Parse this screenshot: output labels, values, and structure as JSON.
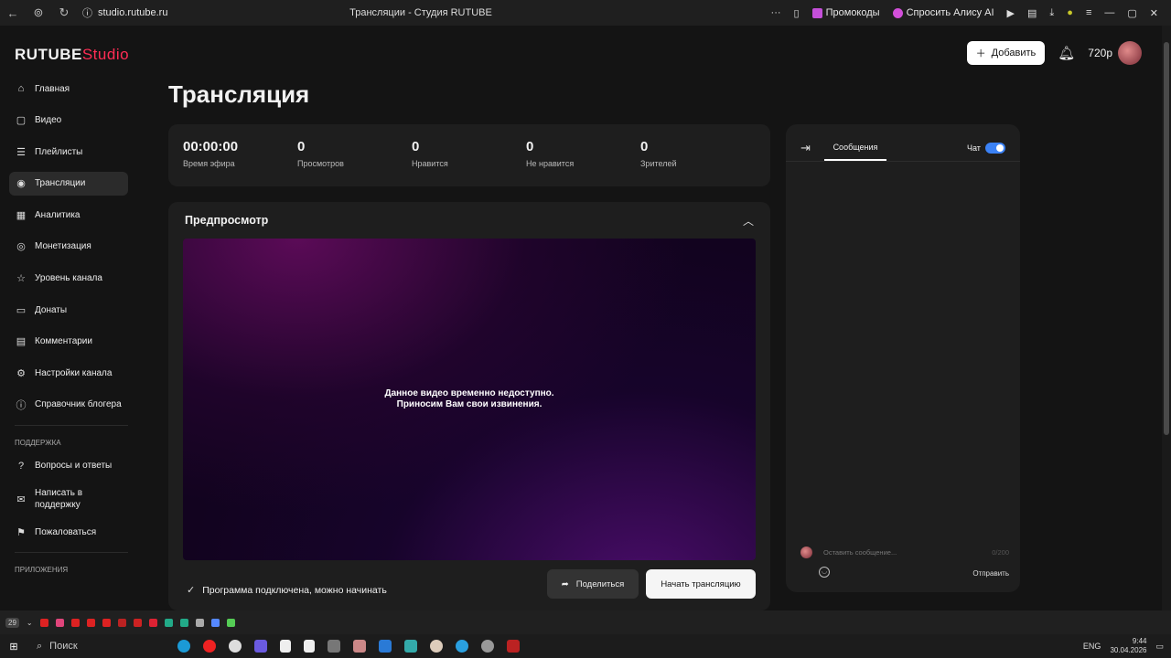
{
  "browser": {
    "url": "studio.rutube.ru",
    "tab_title": "Трансляции - Студия RUTUBE",
    "promo_label": "Промокоды",
    "alice_label": "Спросить Алису AI"
  },
  "header": {
    "logo_main": "RUTUBE",
    "logo_studio": "Studio",
    "add_button": "Добавить",
    "balance": "720р"
  },
  "sidebar": {
    "items": [
      {
        "label": "Главная",
        "icon": "home-icon"
      },
      {
        "label": "Видео",
        "icon": "video-icon"
      },
      {
        "label": "Плейлисты",
        "icon": "playlist-icon"
      },
      {
        "label": "Трансляции",
        "icon": "broadcast-icon",
        "active": true
      },
      {
        "label": "Аналитика",
        "icon": "analytics-icon"
      },
      {
        "label": "Монетизация",
        "icon": "money-icon"
      },
      {
        "label": "Уровень канала",
        "icon": "star-icon"
      },
      {
        "label": "Донаты",
        "icon": "donate-icon"
      },
      {
        "label": "Комментарии",
        "icon": "comments-icon"
      },
      {
        "label": "Настройки канала",
        "icon": "gear-icon"
      },
      {
        "label": "Справочник блогера",
        "icon": "info-icon"
      }
    ],
    "support_section": "ПОДДЕРЖКА",
    "support_items": [
      {
        "label": "Вопросы и ответы",
        "icon": "question-icon"
      },
      {
        "label": "Написать в поддержку",
        "icon": "mail-icon"
      },
      {
        "label": "Пожаловаться",
        "icon": "flag-icon"
      }
    ],
    "apps_section": "ПРИЛОЖЕНИЯ"
  },
  "main": {
    "title": "Трансляция",
    "stats": [
      {
        "value": "00:00:00",
        "label": "Время эфира"
      },
      {
        "value": "0",
        "label": "Просмотров"
      },
      {
        "value": "0",
        "label": "Нравится"
      },
      {
        "value": "0",
        "label": "Не нравится"
      },
      {
        "value": "0",
        "label": "Зрителей"
      }
    ],
    "preview": {
      "title": "Предпросмотр",
      "message_line1": "Данное видео временно недоступно.",
      "message_line2": "Приносим Вам свои извинения.",
      "status": "Программа подключена, можно начинать",
      "share_button": "Поделиться",
      "start_button": "Начать трансляцию"
    }
  },
  "chat": {
    "tab_messages": "Сообщения",
    "chat_toggle_label": "Чат",
    "chat_enabled": true,
    "input_placeholder": "Оставить сообщение...",
    "counter": "0/200",
    "send_button": "Отправить"
  },
  "taskbar": {
    "search_placeholder": "Поиск",
    "lang": "ENG",
    "time": "9:44",
    "date": "30.04.2026",
    "badge": "29"
  },
  "colors": {
    "accent": "#ff2d55",
    "toggle": "#3b82f6",
    "background": "#141414",
    "card": "#1e1e1e"
  }
}
